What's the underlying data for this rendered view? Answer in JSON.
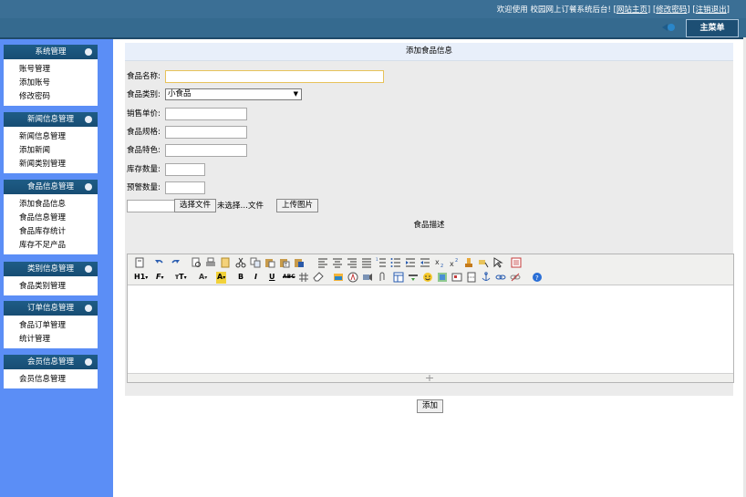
{
  "topbar": {
    "welcome_text": "欢迎使用 校园网上订餐系统后台!",
    "link_home": "网站主页",
    "link_password": "修改密码",
    "link_logout": "注销退出",
    "bracket_open": "[",
    "bracket_close": "]"
  },
  "main_menu_label": "主菜单",
  "sidebar": {
    "groups": [
      {
        "title": "系统管理",
        "items": [
          "账号管理",
          "添加账号",
          "修改密码"
        ]
      },
      {
        "title": "新闻信息管理",
        "items": [
          "新闻信息管理",
          "添加新闻",
          "新闻类别管理"
        ]
      },
      {
        "title": "食品信息管理",
        "items": [
          "添加食品信息",
          "食品信息管理",
          "食品库存统计",
          "库存不足产品"
        ]
      },
      {
        "title": "类别信息管理",
        "items": [
          "食品类别管理"
        ]
      },
      {
        "title": "订单信息管理",
        "items": [
          "食品订单管理",
          "统计管理"
        ]
      },
      {
        "title": "会员信息管理",
        "items": [
          "会员信息管理"
        ]
      }
    ]
  },
  "page_title": "添加食品信息",
  "form": {
    "name_label": "食品名称:",
    "category_label": "食品类别:",
    "category_value": "小食品",
    "price_label": "销售单价:",
    "spec_label": "食品规格:",
    "feature_label": "食品特色:",
    "stock_label": "库存数量:",
    "warning_label": "预警数量:",
    "choose_file_label": "选择文件",
    "no_file_label": "未选择…文件",
    "upload_label": "上传图片",
    "description_label": "食品描述",
    "submit_label": "添加"
  },
  "editor_toolbar": {
    "heading_label": "H1",
    "font_label": "F",
    "size_label": "T"
  },
  "colors": {
    "topbar": "#3b6f95",
    "sidebar_bg": "#5b8ef6",
    "group_header": "#1e5c86",
    "page_title_bg": "#e8effa",
    "form_bg": "#ebebeb"
  }
}
